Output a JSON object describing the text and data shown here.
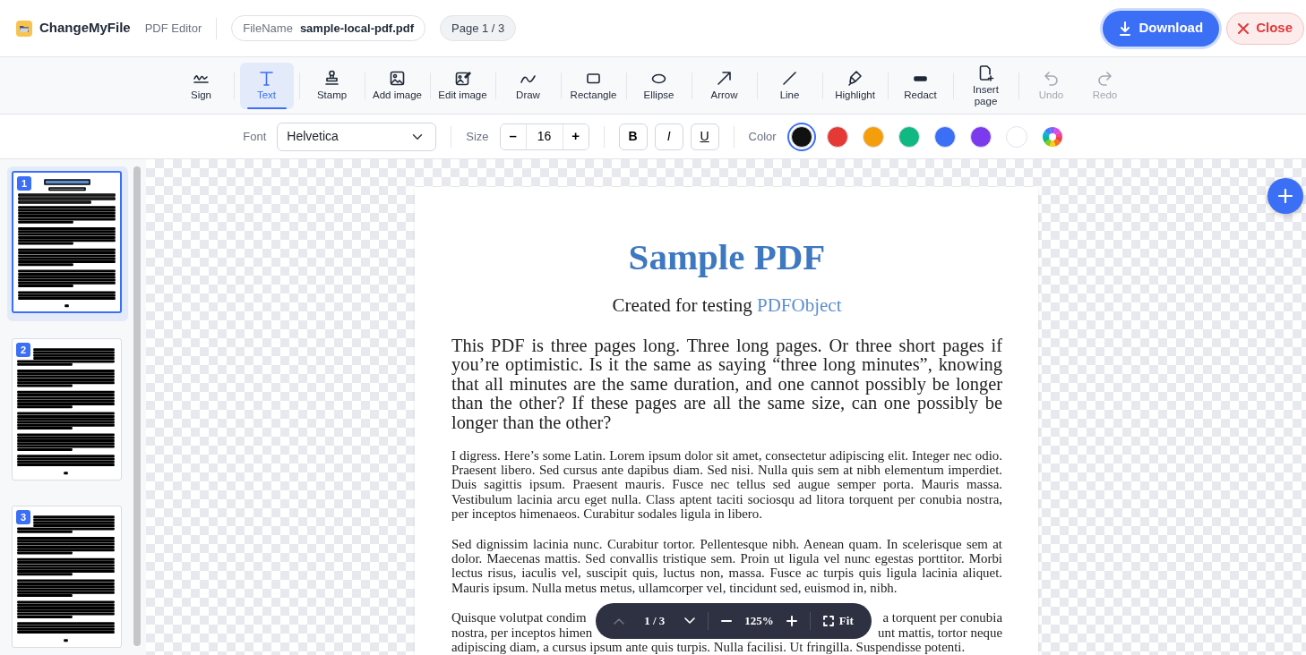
{
  "app": {
    "name": "ChangeMyFile",
    "subtitle": "PDF Editor"
  },
  "file": {
    "label": "FileName",
    "value": "sample-local-pdf.pdf"
  },
  "page_indicator": "Page 1 / 3",
  "actions": [
    {
      "label": "Download",
      "kind": "primary"
    },
    {
      "label": "Close",
      "kind": "danger"
    }
  ],
  "tools": [
    {
      "label": "Sign",
      "selected": false,
      "disabled": false
    },
    {
      "label": "Text",
      "selected": true,
      "disabled": false
    },
    {
      "label": "Stamp",
      "selected": false,
      "disabled": false
    },
    {
      "label": "Add image",
      "selected": false,
      "disabled": false
    },
    {
      "label": "Edit image",
      "selected": false,
      "disabled": false
    },
    {
      "label": "Draw",
      "selected": false,
      "disabled": false
    },
    {
      "label": "Rectangle",
      "selected": false,
      "disabled": false
    },
    {
      "label": "Ellipse",
      "selected": false,
      "disabled": false
    },
    {
      "label": "Arrow",
      "selected": false,
      "disabled": false
    },
    {
      "label": "Line",
      "selected": false,
      "disabled": false
    },
    {
      "label": "Highlight",
      "selected": false,
      "disabled": false
    },
    {
      "label": "Redact",
      "selected": false,
      "disabled": false
    },
    {
      "label": "Insert page",
      "selected": false,
      "disabled": false
    },
    {
      "label": "Undo",
      "selected": false,
      "disabled": true
    },
    {
      "label": "Redo",
      "selected": false,
      "disabled": true
    }
  ],
  "format": {
    "font_label": "Font",
    "font": "Helvetica",
    "size_label": "Size",
    "decrease": "–",
    "size": "16",
    "increase": "+",
    "styles": [
      {
        "label": "B",
        "kind": "bold"
      },
      {
        "label": "I",
        "kind": "italic"
      },
      {
        "label": "U",
        "kind": "underline"
      }
    ],
    "color_label": "Color",
    "colors": [
      {
        "color": "#111111",
        "selected": true
      },
      {
        "color": "#e53935",
        "selected": false
      },
      {
        "color": "#f59e0b",
        "selected": false
      },
      {
        "color": "#10b981",
        "selected": false
      },
      {
        "color": "#3b6ff5",
        "selected": false
      },
      {
        "color": "#7c3aed",
        "selected": false
      },
      {
        "color": "#ffffff",
        "selected": false
      }
    ]
  },
  "thumbnails": [
    {
      "number": "1",
      "selected": true
    },
    {
      "number": "2",
      "selected": false
    },
    {
      "number": "3",
      "selected": false
    }
  ],
  "document": {
    "title": "Sample PDF",
    "subtitle": "Created for testing",
    "subtitle_link": "PDFObject",
    "paragraphs": [
      "This PDF is three pages long. Three long pages. Or three short pages if you’re optimistic. Is it the same as saying “three long minutes”, knowing that all minutes are the same duration, and one cannot possibly be longer than the other? If these pages are all the same size, can one possibly be longer than the other?",
      "I digress. Here’s some Latin. Lorem ipsum dolor sit amet, consectetur adipiscing elit. Integer nec odio. Praesent libero. Sed cursus ante dapibus diam. Sed nisi. Nulla quis sem at nibh elementum imperdiet. Duis sagittis ipsum. Praesent mauris. Fusce nec tellus sed augue semper porta. Mauris massa. Vestibulum lacinia arcu eget nulla. Class aptent taciti sociosqu ad litora torquent per conubia nostra, per inceptos himenaeos. Curabitur sodales ligula in libero.",
      "Sed dignissim lacinia nunc. Curabitur tortor. Pellentesque nibh. Aenean quam. In scelerisque sem at dolor. Maecenas mattis. Sed convallis tristique sem. Proin ut ligula vel nunc egestas porttitor. Morbi lectus risus, iaculis vel, suscipit quis, luctus non, massa. Fusce ac turpis quis ligula lacinia aliquet. Mauris ipsum. Nulla metus metus, ullamcorper vel, tincidunt sed, euismod in, nibh."
    ],
    "partial_lines": [
      {
        "left": "Quisque volutpat condim",
        "right": "a torquent per conubia"
      },
      {
        "left": "nostra, per inceptos himen",
        "right": "unt mattis, tortor neque"
      },
      {
        "left": "adipiscing diam, a cursus ipsum ante quis turpis. Nulla facilisi. Ut fringilla. Suspendisse potenti."
      }
    ]
  },
  "zoom_bar": {
    "page": "1 / 3",
    "prev_disabled": true,
    "zoom": "125%",
    "fit": "Fit"
  }
}
